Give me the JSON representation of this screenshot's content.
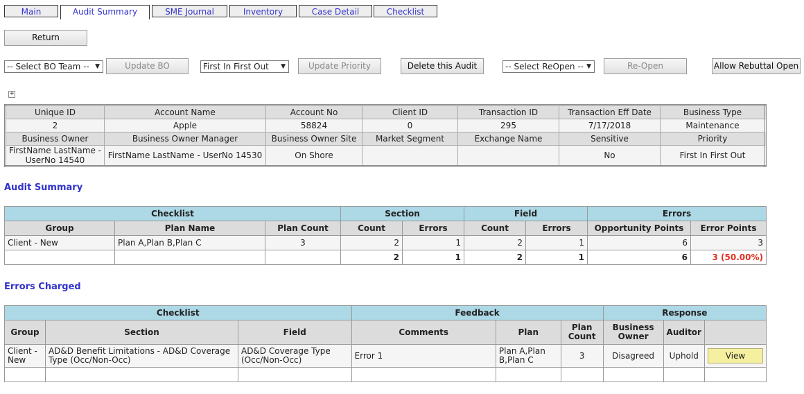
{
  "tabs": [
    "Main",
    "Audit Summary",
    "SME Journal",
    "Inventory",
    "Case Detail",
    "Checklist"
  ],
  "buttons": {
    "return": "Return",
    "update_bo": "Update BO",
    "update_priority": "Update Priority",
    "delete_audit": "Delete this Audit",
    "reopen": "Re-Open",
    "allow_rebuttal": "Allow Rebuttal Open"
  },
  "selects": {
    "bo_team": "-- Select BO Team --",
    "priority": "First In First Out",
    "reopen": "-- Select ReOpen --"
  },
  "info": {
    "headers1": [
      "Unique ID",
      "Account Name",
      "Account No",
      "Client ID",
      "Transaction ID",
      "Transaction Eff Date",
      "Business Type"
    ],
    "values1": [
      "2",
      "Apple",
      "58824",
      "0",
      "295",
      "7/17/2018",
      "Maintenance"
    ],
    "headers2": [
      "Business Owner",
      "Business Owner Manager",
      "Business Owner Site",
      "Market Segment",
      "Exchange Name",
      "Sensitive",
      "Priority"
    ],
    "values2": [
      "FirstName LastName - UserNo 14540",
      "FirstName LastName - UserNo 14530",
      "On Shore",
      "",
      "",
      "No",
      "First In First Out"
    ]
  },
  "audit_summary": {
    "title": "Audit Summary",
    "groups": [
      "Checklist",
      "Section",
      "Field",
      "Errors"
    ],
    "columns": [
      "Group",
      "Plan Name",
      "Plan Count",
      "Count",
      "Errors",
      "Count",
      "Errors",
      "Opportunity Points",
      "Error Points"
    ],
    "row": [
      "Client - New",
      "Plan A,Plan B,Plan C",
      "3",
      "2",
      "1",
      "2",
      "1",
      "6",
      "3"
    ],
    "totals": [
      "",
      "",
      "",
      "2",
      "1",
      "2",
      "1",
      "6",
      "3 (50.00%)"
    ]
  },
  "errors_charged": {
    "title": "Errors Charged",
    "groups": [
      "Checklist",
      "Feedback",
      "Response"
    ],
    "columns": [
      "Group",
      "Section",
      "Field",
      "Comments",
      "Plan",
      "Plan Count",
      "Business Owner",
      "Auditor",
      ""
    ],
    "row": {
      "group": "Client - New",
      "section": "AD&D Benefit Limitations - AD&D Coverage Type (Occ/Non-Occ)",
      "field": "AD&D Coverage Type (Occ/Non-Occ)",
      "comments": "Error 1",
      "plan": "Plan A,Plan B,Plan C",
      "plan_count": "3",
      "business_owner": "Disagreed",
      "auditor": "Uphold",
      "view": "View"
    }
  },
  "icons": {
    "expand": "plus-box-icon"
  },
  "colors": {
    "section_title": "#3333cc",
    "table_header": "#add8e6",
    "error_highlight": "#e53020",
    "view_button": "#f5f0a0"
  }
}
